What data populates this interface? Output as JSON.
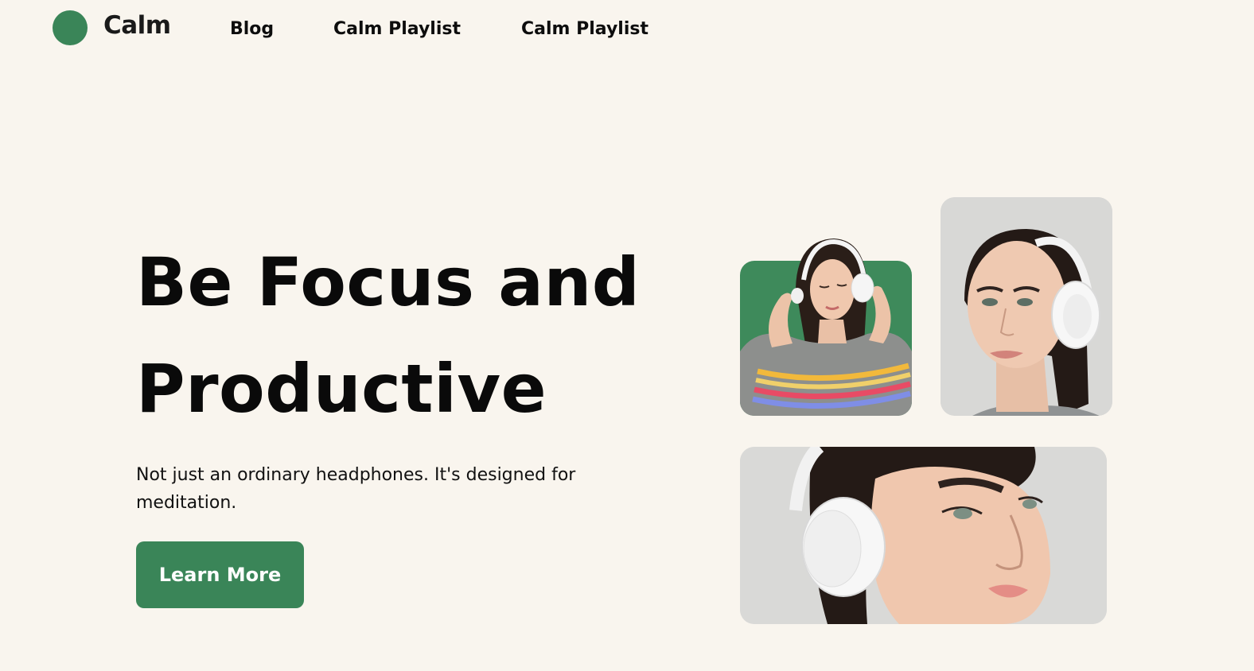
{
  "brand": {
    "name": "Calm",
    "accent_color": "#3a8558"
  },
  "nav": {
    "links": [
      {
        "label": "Blog"
      },
      {
        "label": "Calm Playlist"
      },
      {
        "label": "Calm Playlist"
      }
    ]
  },
  "hero": {
    "title_line1": "Be Focus and",
    "title_line2": "Productive",
    "subtitle": "Not just an ordinary headphones. It's designed for meditation.",
    "cta_label": "Learn More"
  },
  "gallery": {
    "images": [
      {
        "subject": "woman-with-headphones-green-background"
      },
      {
        "subject": "woman-with-headphones-portrait"
      },
      {
        "subject": "woman-with-headphones-closeup"
      }
    ]
  }
}
